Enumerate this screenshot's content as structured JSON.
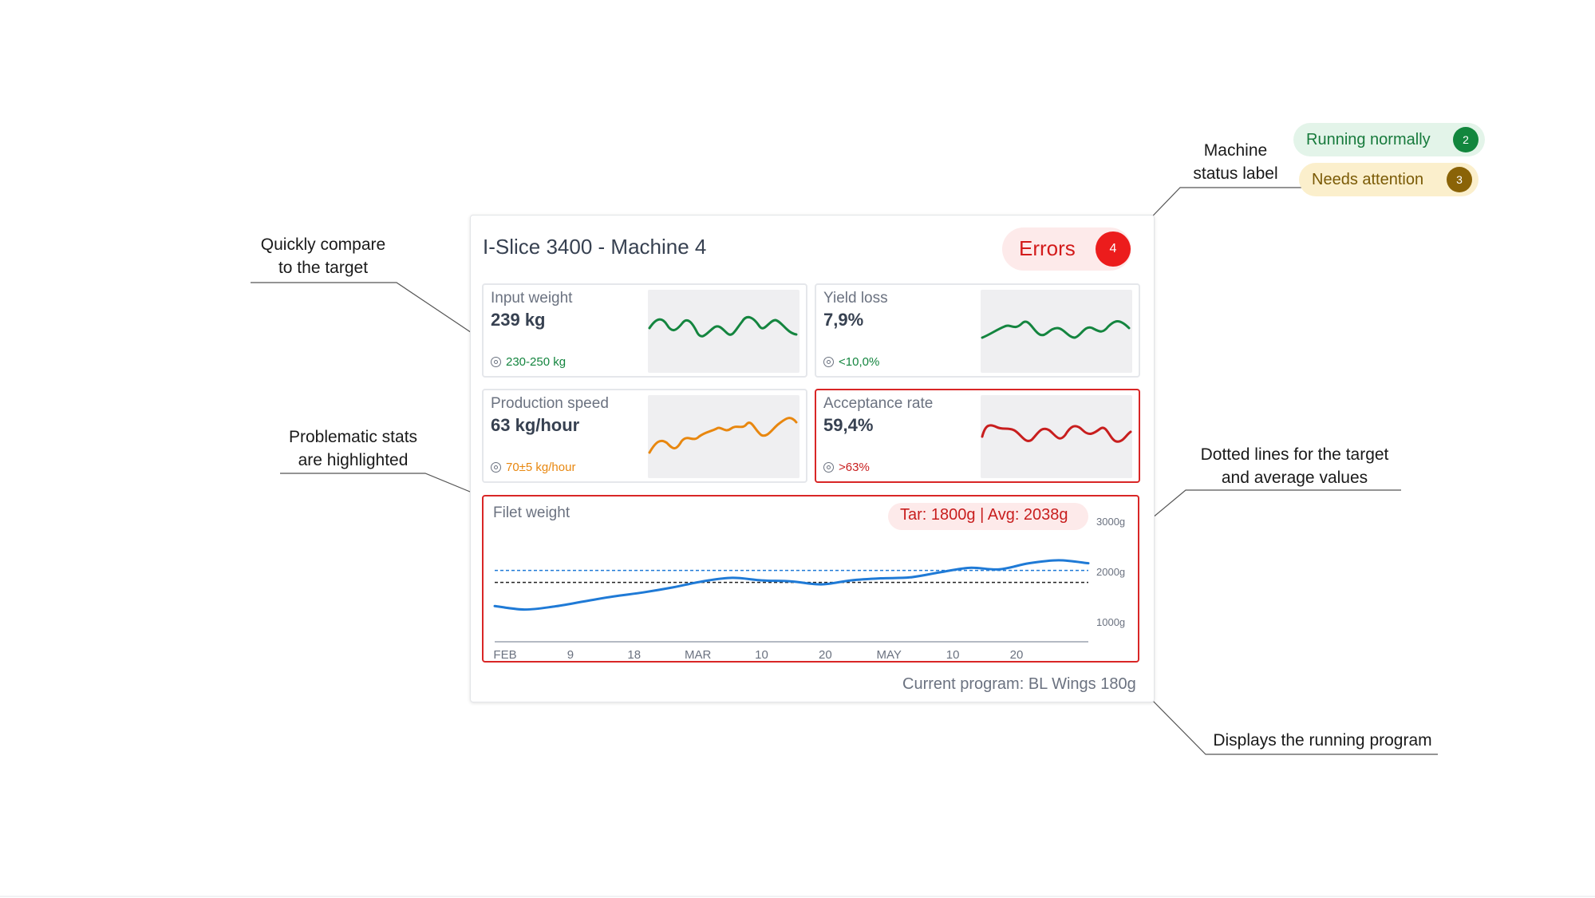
{
  "legend": {
    "running": {
      "label": "Running normally",
      "count": "2",
      "color": "#12863d"
    },
    "attention": {
      "label": "Needs attention",
      "count": "3",
      "color": "#8a6307"
    }
  },
  "annotations": {
    "status_label": "Machine\nstatus label",
    "compare": "Quickly compare\nto the target",
    "problematic": "Problematic stats\nare highlighted",
    "dotted": "Dotted lines for the target\nand average values",
    "program": "Displays the running program"
  },
  "card": {
    "title": "I-Slice 3400 - Machine 4",
    "status": {
      "label": "Errors",
      "count": "4",
      "color": "#ec1c1c"
    },
    "stats": [
      {
        "label": "Input weight",
        "value": "239 kg",
        "target": "230-250 kg",
        "color": "#14853f",
        "icon": "target-icon"
      },
      {
        "label": "Yield loss",
        "value": "7,9%",
        "target": "<10,0%",
        "color": "#14853f",
        "icon": "target-icon"
      },
      {
        "label": "Production speed",
        "value": "63 kg/hour",
        "target": "70±5 kg/hour",
        "color": "#e8870f",
        "icon": "target-icon"
      },
      {
        "label": "Acceptance rate",
        "value": "59,4%",
        "target": ">63%",
        "color": "#c81e1e",
        "icon": "target-icon"
      }
    ],
    "filet": {
      "title": "Filet weight",
      "badge": "Tar: 1800g | Avg: 2038g",
      "program": "Current program: BL Wings 180g"
    }
  },
  "chart_data": {
    "type": "line",
    "title": "Filet weight",
    "x_tick_labels": [
      "FEB",
      "9",
      "18",
      "MAR",
      "10",
      "20",
      "MAY",
      "10",
      "20"
    ],
    "y_tick_labels": [
      "3000g",
      "2000g",
      "1000g"
    ],
    "ylim": [
      1000,
      3000
    ],
    "target_line": 1800,
    "average_line": 2038,
    "series": [
      {
        "values": [
          1330,
          1260,
          1320,
          1420,
          1520,
          1600,
          1700,
          1820,
          1890,
          1840,
          1820,
          1760,
          1840,
          1880,
          1900,
          2000,
          2090,
          2060,
          2180,
          2240,
          2180
        ]
      }
    ],
    "line_color": "#1f7ad6",
    "target_color": "#1f7ad6",
    "average_color": "#222222",
    "grid": false
  }
}
